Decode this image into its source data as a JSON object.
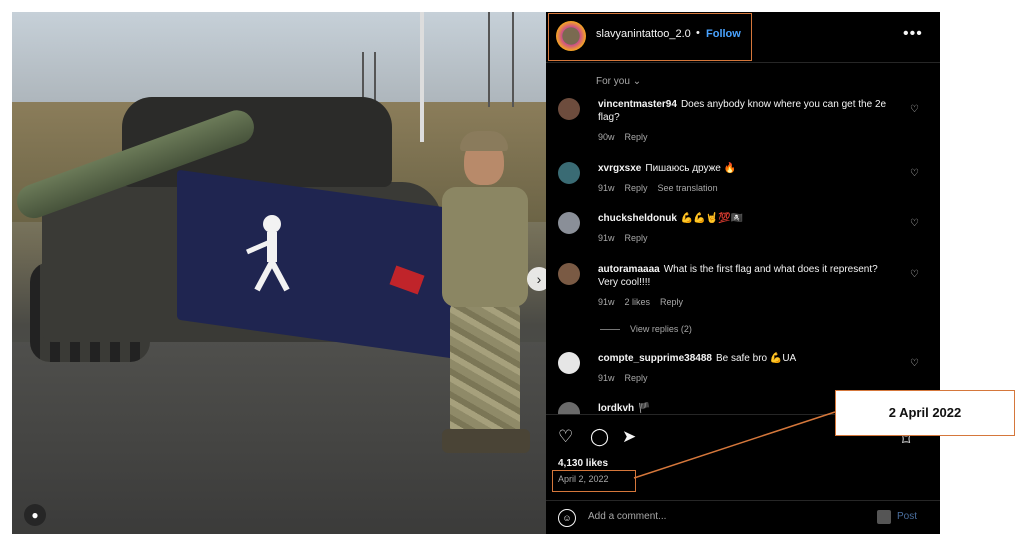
{
  "post": {
    "username": "slavyanintattoo_2.0",
    "separator": "•",
    "follow_label": "Follow",
    "more_icon": "more-horizontal-icon",
    "sort_label": "For you"
  },
  "comments": [
    {
      "user": "vincentmaster94",
      "text": "Does anybody know where you can get the 2e flag?",
      "age": "90w",
      "reply": "Reply",
      "likes": "",
      "translate": ""
    },
    {
      "user": "xvrgxsxe",
      "text": "Пишаюсь друже 🔥",
      "age": "91w",
      "reply": "Reply",
      "likes": "",
      "translate": "See translation"
    },
    {
      "user": "chucksheldonuk",
      "text": "💪💪🤘💯🏴‍☠️",
      "age": "91w",
      "reply": "Reply",
      "likes": "",
      "translate": ""
    },
    {
      "user": "autoramaaaa",
      "text": "What is the first flag and what does it represent? Very cool!!!!",
      "age": "91w",
      "reply": "Reply",
      "likes": "2 likes",
      "translate": ""
    },
    {
      "user": "compte_supprime38488",
      "text": "Be safe bro 💪UA",
      "age": "91w",
      "reply": "Reply",
      "likes": "",
      "translate": ""
    },
    {
      "user": "lordkvh",
      "text": "🏴",
      "age": "",
      "reply": "",
      "likes": "",
      "translate": ""
    }
  ],
  "view_replies": "View replies (2)",
  "likes_count": "4,130 likes",
  "date": "April 2, 2022",
  "add_comment_placeholder": "Add a comment...",
  "post_button": "Post",
  "annotation": "2 April 2022",
  "colors": {
    "accent_blue": "#4aa3ff",
    "annotation_border": "#d5773b",
    "panel_bg": "#000000"
  }
}
